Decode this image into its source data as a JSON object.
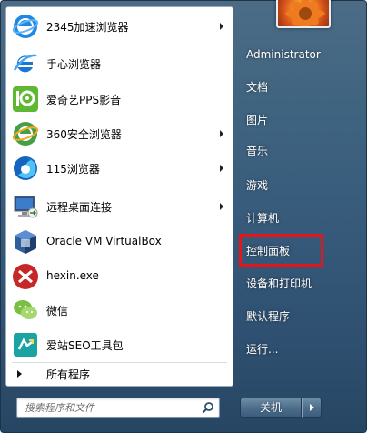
{
  "programs": [
    {
      "label": "2345加速浏览器",
      "icon": "browser-2345-icon",
      "has_submenu": true
    },
    {
      "label": "手心浏览器",
      "icon": "shouxin-browser-icon",
      "has_submenu": false
    },
    {
      "label": "爱奇艺PPS影音",
      "icon": "iqiyi-pps-icon",
      "has_submenu": false
    },
    {
      "label": "360安全浏览器",
      "icon": "360-browser-icon",
      "has_submenu": true
    },
    {
      "label": "115浏览器",
      "icon": "115-browser-icon",
      "has_submenu": true
    },
    {
      "label": "远程桌面连接",
      "icon": "remote-desktop-icon",
      "has_submenu": true
    },
    {
      "label": "Oracle VM VirtualBox",
      "icon": "virtualbox-icon",
      "has_submenu": false
    },
    {
      "label": "hexin.exe",
      "icon": "hexin-icon",
      "has_submenu": false
    },
    {
      "label": "微信",
      "icon": "wechat-icon",
      "has_submenu": false
    },
    {
      "label": "爱站SEO工具包",
      "icon": "aizhan-seo-icon",
      "has_submenu": false
    }
  ],
  "all_programs_label": "所有程序",
  "search": {
    "placeholder": "搜索程序和文件"
  },
  "user_name": "Administrator",
  "right_items": [
    "文档",
    "图片",
    "音乐",
    "游戏",
    "计算机",
    "控制面板",
    "设备和打印机",
    "默认程序",
    "运行..."
  ],
  "highlighted_item": "控制面板",
  "shutdown_label": "关机",
  "colors": {
    "highlight_border": "#e5161a",
    "pane_bg": "#ffffff",
    "menu_bg": "#36597a"
  }
}
